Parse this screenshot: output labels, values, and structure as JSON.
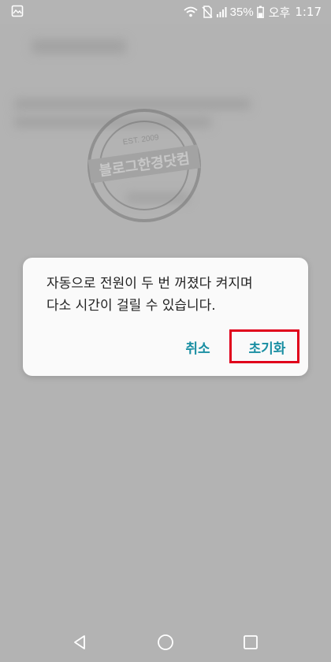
{
  "status_bar": {
    "gallery_icon": "image-icon",
    "wifi_icon": "wifi-icon",
    "no_sim_icon": "no-sim-icon",
    "signal_icon": "signal-bars-icon",
    "battery_text": "35%",
    "battery_icon": "battery-icon",
    "ampm": "오후",
    "time": "1:17"
  },
  "dialog": {
    "message": "자동으로 전원이 두 번 꺼졌다 켜지며\n다소 시간이 걸릴 수 있습니다.",
    "cancel_label": "취소",
    "reset_label": "초기화"
  },
  "watermark": {
    "name": "블로그한경닷컴",
    "est": "EST. 2009"
  },
  "navigation": {
    "back_icon": "back-triangle-icon",
    "home_icon": "home-circle-icon",
    "recent_icon": "recent-square-icon"
  },
  "colors": {
    "accent": "#1a8fa3",
    "highlight": "#e0001b",
    "scrim": "#b3b3b3"
  }
}
